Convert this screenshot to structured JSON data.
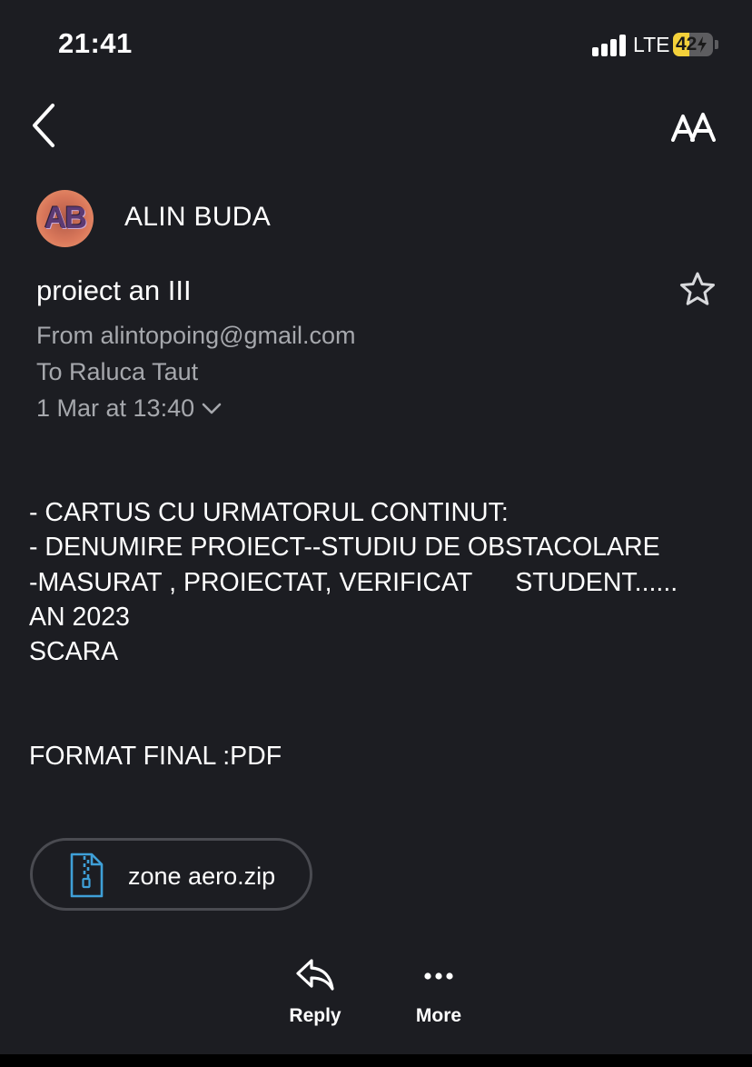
{
  "status_bar": {
    "time": "21:41",
    "network": "LTE",
    "battery_level": "42",
    "battery_fraction": 0.42,
    "battery_color": "#f4d13a"
  },
  "nav": {
    "back_icon": "chevron-left-icon",
    "text_size_icon": "text-size-icon"
  },
  "sender": {
    "avatar_initials": "AB",
    "name": "ALIN BUDA"
  },
  "message": {
    "subject": "proiect an III",
    "from": "From alintopoing@gmail.com",
    "to": "To Raluca Taut",
    "date": "1 Mar at 13:40",
    "star_icon": "star-outline-icon",
    "body_lines": [
      "- CARTUS CU URMATORUL CONTINUT:",
      "- DENUMIRE PROIECT--STUDIU DE OBSTACOLARE",
      "-MASURAT , PROIECTAT, VERIFICAT      STUDENT......",
      "AN 2023",
      "SCARA",
      "FORMAT FINAL :PDF"
    ]
  },
  "attachment": {
    "icon": "zip-file-icon",
    "name": "zone aero.zip",
    "icon_color": "#3fa0d8"
  },
  "actions": {
    "reply_label": "Reply",
    "more_label": "More"
  },
  "colors": {
    "background": "#1c1d22",
    "secondary_text": "#a6a8ad"
  }
}
